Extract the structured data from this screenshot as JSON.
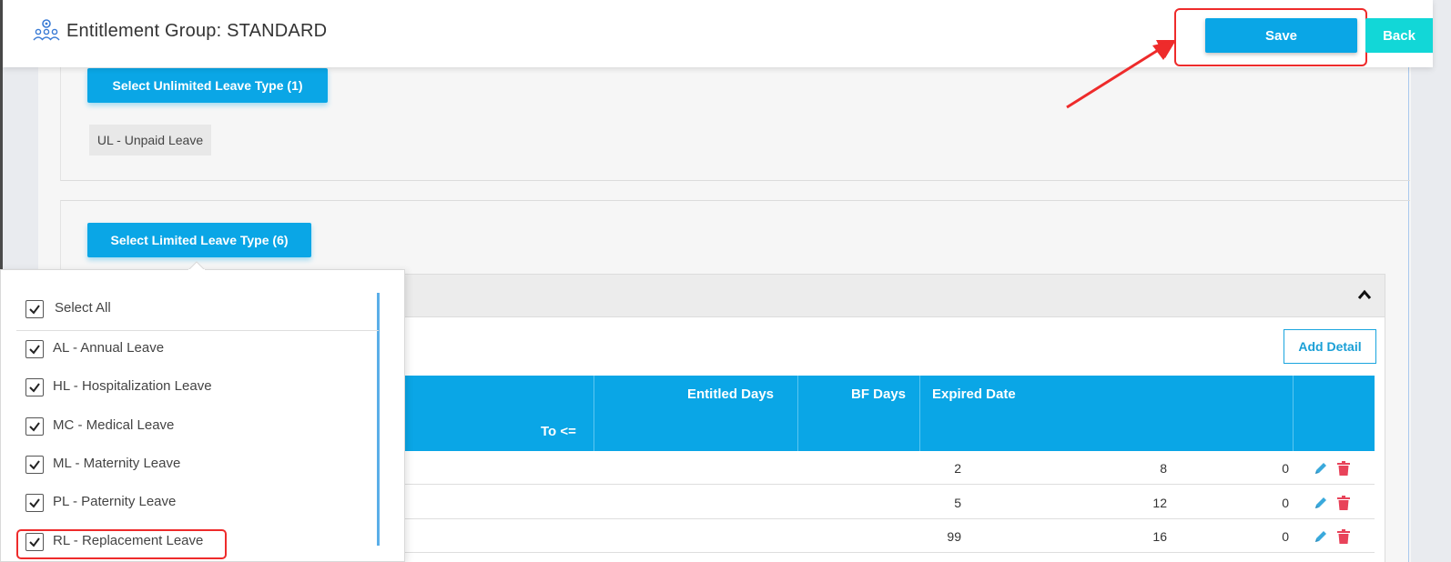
{
  "header": {
    "title": "Entitlement Group: STANDARD",
    "save_label": "Save",
    "back_label": "Back"
  },
  "unlimited": {
    "button_label": "Select Unlimited Leave Type (1)",
    "selected": [
      "UL - Unpaid Leave"
    ]
  },
  "limited": {
    "button_label": "Select Limited Leave Type (6)"
  },
  "detail": {
    "add_label": "Add Detail",
    "columns": {
      "to": "To <=",
      "entitled": "Entitled Days",
      "bf": "BF Days",
      "expired": "Expired Date"
    },
    "rows": [
      {
        "to": "2",
        "entitled": "8",
        "bf": "0",
        "expired": ""
      },
      {
        "to": "5",
        "entitled": "12",
        "bf": "0",
        "expired": ""
      },
      {
        "to": "99",
        "entitled": "16",
        "bf": "0",
        "expired": ""
      }
    ]
  },
  "dropdown": {
    "select_all": "Select All",
    "items": [
      {
        "label": "AL - Annual Leave",
        "checked": true
      },
      {
        "label": "HL - Hospitalization Leave",
        "checked": true
      },
      {
        "label": "MC - Medical Leave",
        "checked": true
      },
      {
        "label": "ML - Maternity Leave",
        "checked": true
      },
      {
        "label": "PL - Paternity Leave",
        "checked": true
      },
      {
        "label": "RL - Replacement Leave",
        "checked": true
      }
    ]
  },
  "colors": {
    "primary": "#0aa6e6",
    "back": "#12d7d7",
    "highlight": "#ee2b2b",
    "edit_icon": "#3aa9dc",
    "delete_icon": "#e8435a"
  },
  "icons": {
    "logo": "people-gear-icon",
    "edit": "pencil-icon",
    "delete": "trash-icon",
    "collapse": "chevron-up-icon",
    "check": "check-icon"
  }
}
